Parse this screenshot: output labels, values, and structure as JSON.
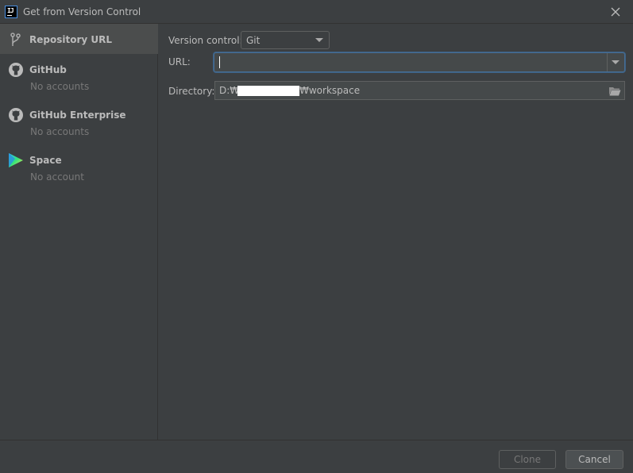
{
  "window": {
    "title": "Get from Version Control"
  },
  "sidebar": {
    "items": [
      {
        "label": "Repository URL",
        "sub": "",
        "icon": "branch-icon",
        "selected": true
      },
      {
        "label": "GitHub",
        "sub": "No accounts",
        "icon": "github-icon",
        "selected": false
      },
      {
        "label": "GitHub Enterprise",
        "sub": "No accounts",
        "icon": "github-icon",
        "selected": false
      },
      {
        "label": "Space",
        "sub": "No account",
        "icon": "space-icon",
        "selected": false
      }
    ]
  },
  "form": {
    "version_control_label": "Version control:",
    "version_control_value": "Git",
    "url_label": "URL:",
    "url_value": "",
    "directory_label": "Directory:",
    "directory_prefix": "D:₩",
    "directory_suffix": "₩workspace"
  },
  "buttons": {
    "clone": "Clone",
    "cancel": "Cancel"
  },
  "colors": {
    "background": "#3c3f41",
    "selected_row": "#4b4d4d",
    "focus_border": "#466d94",
    "text": "#bbbbbb",
    "muted_text": "#787878"
  }
}
